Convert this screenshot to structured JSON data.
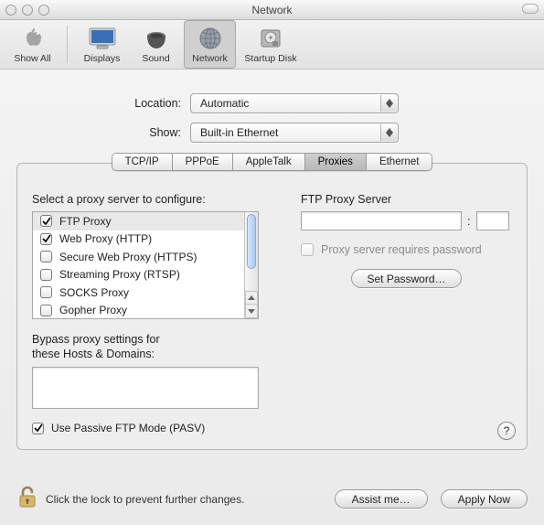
{
  "window": {
    "title": "Network"
  },
  "toolbar": {
    "items": [
      {
        "label": "Show All",
        "icon": "apple"
      },
      {
        "label": "Displays",
        "icon": "display"
      },
      {
        "label": "Sound",
        "icon": "speaker"
      },
      {
        "label": "Network",
        "icon": "globe",
        "selected": true
      },
      {
        "label": "Startup Disk",
        "icon": "disk"
      }
    ]
  },
  "dropdowns": {
    "location_label": "Location:",
    "location_value": "Automatic",
    "show_label": "Show:",
    "show_value": "Built-in Ethernet"
  },
  "tabs": {
    "items": [
      "TCP/IP",
      "PPPoE",
      "AppleTalk",
      "Proxies",
      "Ethernet"
    ],
    "active": "Proxies"
  },
  "proxies": {
    "list_label": "Select a proxy server to configure:",
    "items": [
      {
        "label": "FTP Proxy",
        "checked": true,
        "selected": true
      },
      {
        "label": "Web Proxy (HTTP)",
        "checked": true
      },
      {
        "label": "Secure Web Proxy (HTTPS)",
        "checked": false
      },
      {
        "label": "Streaming Proxy (RTSP)",
        "checked": false
      },
      {
        "label": "SOCKS Proxy",
        "checked": false
      },
      {
        "label": "Gopher Proxy",
        "checked": false
      }
    ],
    "bypass_label_1": "Bypass proxy settings for",
    "bypass_label_2": "these Hosts & Domains:",
    "pasv_label": "Use Passive FTP Mode (PASV)",
    "pasv_checked": true
  },
  "right": {
    "title": "FTP Proxy Server",
    "host": "",
    "port": "",
    "colon": ":",
    "requires_password_label": "Proxy server requires password",
    "set_password_label": "Set Password…"
  },
  "bottom": {
    "lock_label": "Click the lock to prevent further changes.",
    "assist_label": "Assist me…",
    "apply_label": "Apply Now"
  },
  "help": {
    "label": "?"
  }
}
